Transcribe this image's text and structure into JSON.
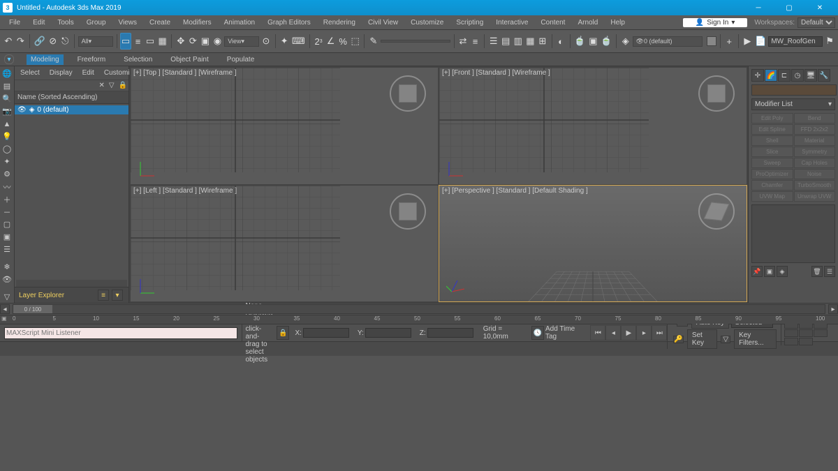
{
  "title": "Untitled - Autodesk 3ds Max 2019",
  "menu": [
    "File",
    "Edit",
    "Tools",
    "Group",
    "Views",
    "Create",
    "Modifiers",
    "Animation",
    "Graph Editors",
    "Rendering",
    "Civil View",
    "Customize",
    "Scripting",
    "Interactive",
    "Content",
    "Arnold",
    "Help"
  ],
  "signin": "Sign In",
  "workspaces_label": "Workspaces:",
  "workspaces_value": "Default",
  "toolbar": {
    "all": "All",
    "view": "View",
    "isolate_set": "0 (default)",
    "script_name": "MW_RoofGen"
  },
  "ribbon": [
    "Modeling",
    "Freeform",
    "Selection",
    "Object Paint",
    "Populate"
  ],
  "scene_explorer": {
    "menu": [
      "Select",
      "Display",
      "Edit",
      "Customize"
    ],
    "column": "Name (Sorted Ascending)",
    "row0": "0 (default)",
    "footer": "Layer Explorer"
  },
  "viewports": {
    "top": "[+] [Top ] [Standard ] [Wireframe ]",
    "front": "[+] [Front ] [Standard ] [Wireframe ]",
    "left": "[+] [Left ] [Standard ] [Wireframe ]",
    "persp": "[+] [Perspective ] [Standard ] [Default Shading ]"
  },
  "command_panel": {
    "modifier_list": "Modifier List",
    "buttons": [
      "Edit Poly",
      "Bend",
      "Edit Spline",
      "FFD 2x2x2",
      "Shell",
      "Material",
      "Slice",
      "Symmetry",
      "Sweep",
      "Cap Holes",
      "ProOptimizer",
      "Noise",
      "Chamfer",
      "TurboSmooth",
      "UVW Map",
      "Unwrap UVW"
    ]
  },
  "time": {
    "thumb": "0 / 100",
    "ticks": [
      "0",
      "5",
      "10",
      "15",
      "20",
      "25",
      "30",
      "35",
      "40",
      "45",
      "50",
      "55",
      "60",
      "65",
      "70",
      "75",
      "80",
      "85",
      "90",
      "95",
      "100"
    ]
  },
  "status": {
    "listener": "MAXScript Mini Listener",
    "line1": "None Selected",
    "line2": "Click or click-and-drag to select objects",
    "x_label": "X:",
    "x_val": "",
    "y_label": "Y:",
    "y_val": "",
    "z_label": "Z:",
    "z_val": "",
    "grid": "Grid = 10,0mm",
    "timetag": "Add Time Tag",
    "autokey": "Auto Key",
    "selected": "Selected",
    "setkey": "Set Key",
    "keyfilters": "Key Filters..."
  }
}
